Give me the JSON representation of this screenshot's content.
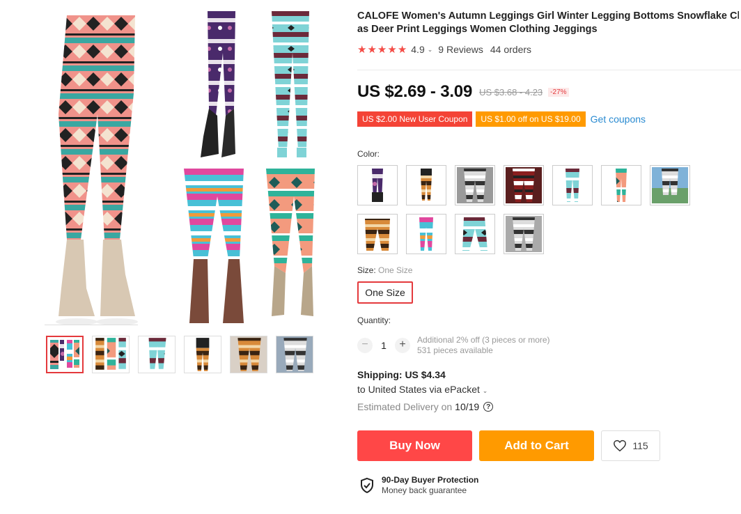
{
  "product": {
    "title_line1": "CALOFE Women's Autumn Leggings Girl Winter Legging Bottoms Snowflake Christm",
    "title_line2": "as Deer Print Leggings Women Clothing Jeggings",
    "rating": "4.9",
    "reviews": "9 Reviews",
    "orders": "44 orders",
    "star_icons": [
      "star-icon",
      "star-icon",
      "star-icon",
      "star-icon",
      "star-icon"
    ]
  },
  "price": {
    "current": "US $2.69 - 3.09",
    "original": "US $3.68 - 4.23",
    "discount": "-27%"
  },
  "coupons": {
    "new_user": "US $2.00 New User Coupon",
    "off": "US $1.00 off on US $19.00",
    "get": "Get coupons"
  },
  "color": {
    "label": "Color:"
  },
  "size": {
    "label": "Size:",
    "selected": "One Size",
    "button": "One Size"
  },
  "quantity": {
    "label": "Quantity:",
    "minus": "−",
    "value": "1",
    "plus": "+",
    "note1": "Additional 2% off (3 pieces or more)",
    "note2": "531 pieces available"
  },
  "shipping": {
    "label": "Shipping:",
    "price": "US $4.34",
    "to": "to United States via ePacket",
    "delivery_label": "Estimated Delivery on",
    "delivery_date": "10/19",
    "help": "?"
  },
  "actions": {
    "buy": "Buy Now",
    "cart": "Add to Cart",
    "wishlist_count": "115"
  },
  "protection": {
    "title": "90-Day Buyer Protection",
    "subtitle": "Money back guarantee"
  },
  "colors": {
    "accent_red": "#ff4747",
    "accent_orange": "#ff9a00",
    "link_blue": "#2a8bd1",
    "star_red": "#f44c46"
  }
}
